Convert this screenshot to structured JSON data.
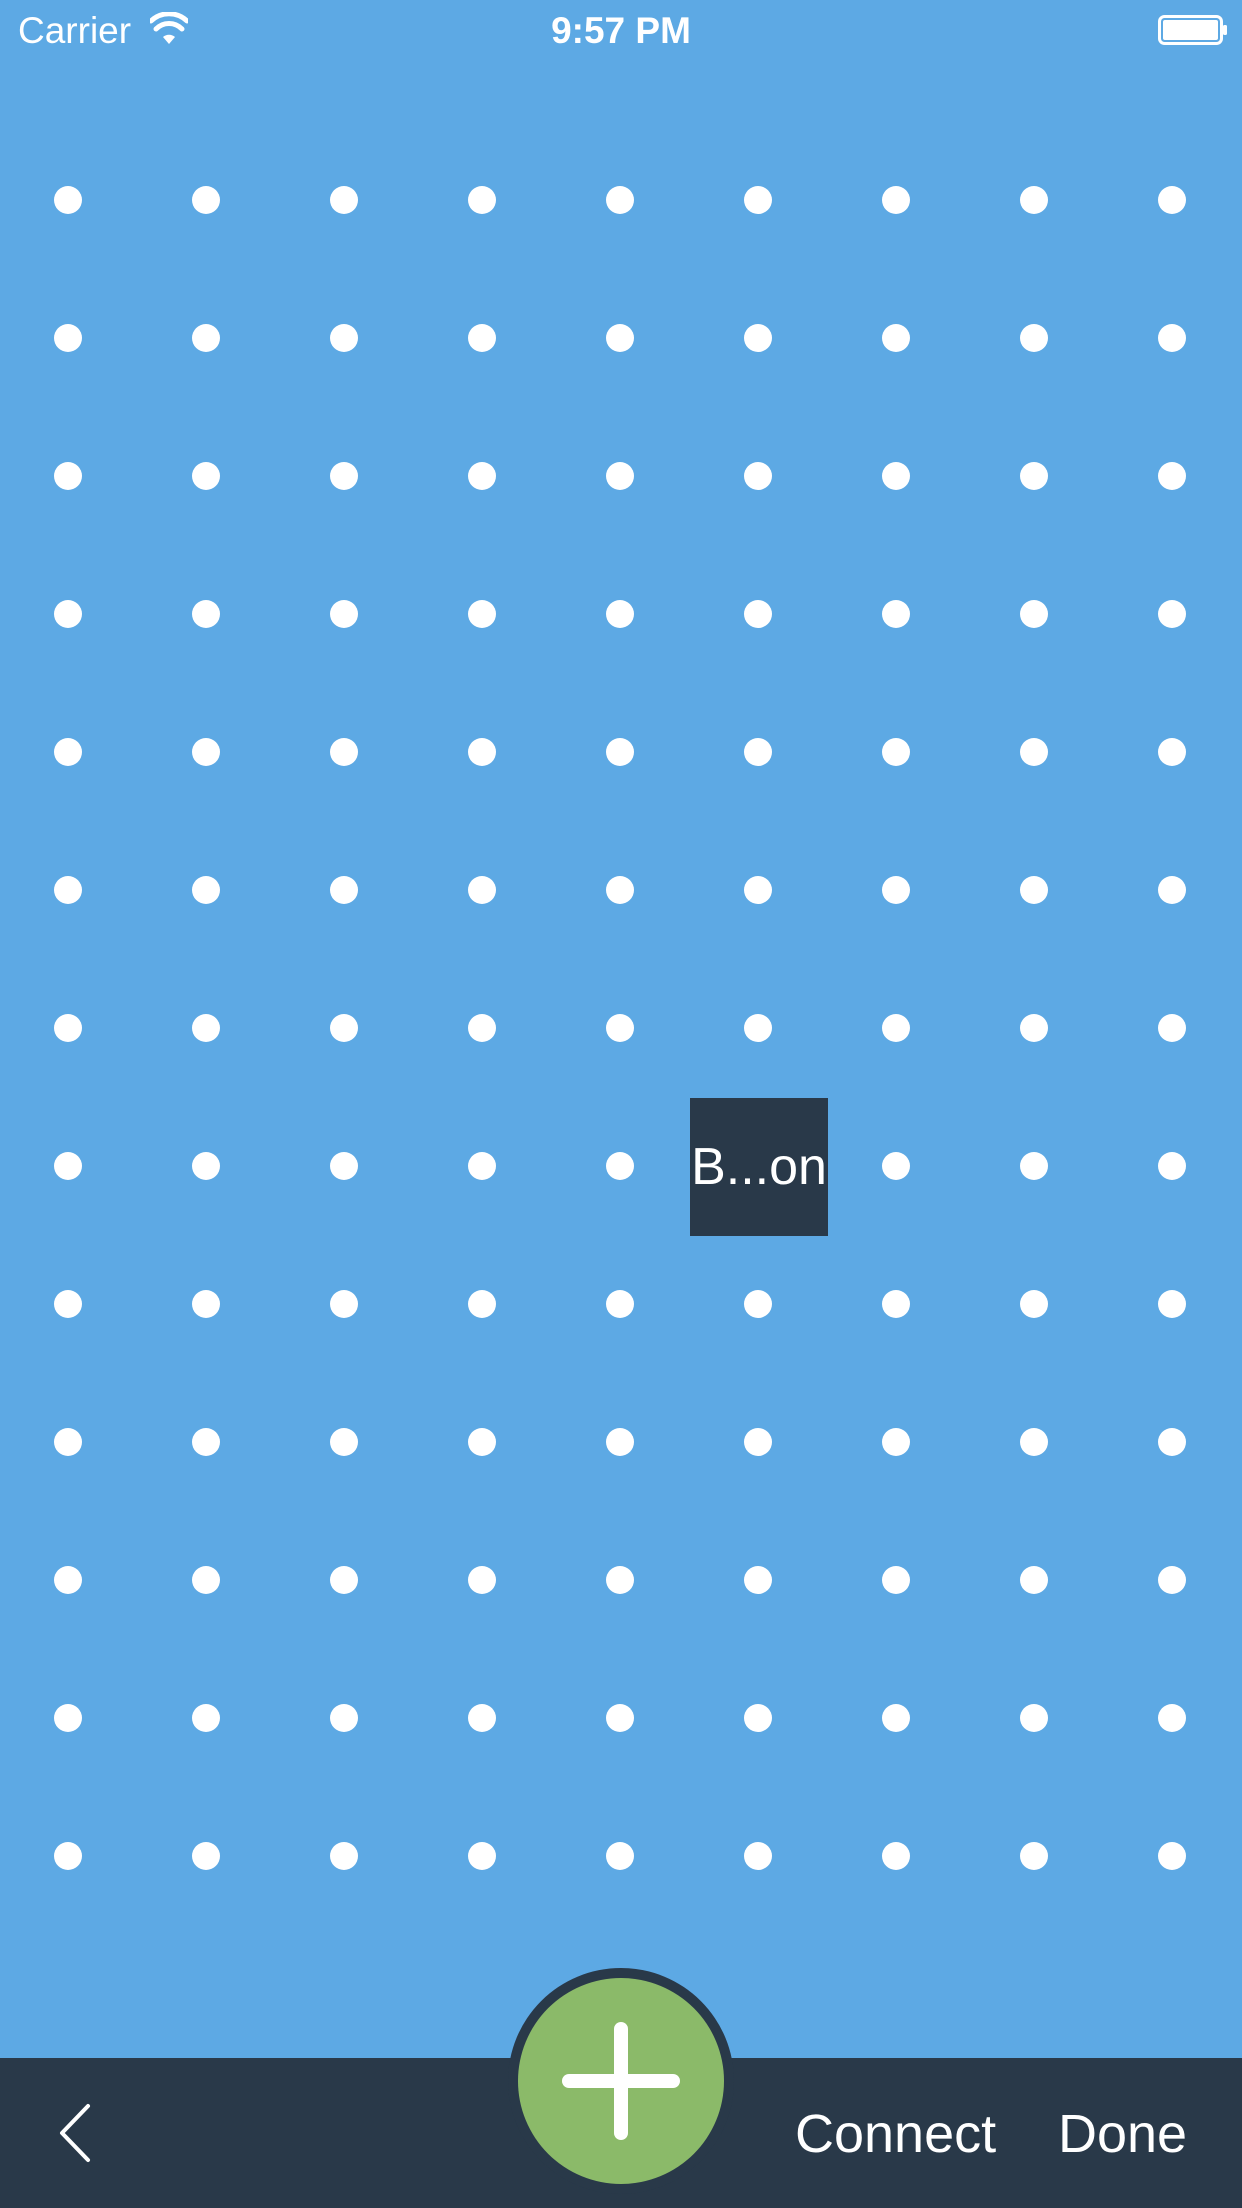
{
  "status_bar": {
    "carrier": "Carrier",
    "time": "9:57 PM",
    "wifi_icon": "wifi-icon",
    "battery_icon": "battery-icon"
  },
  "canvas": {
    "background_color": "#5DA9E4",
    "dot_color": "#FFFFFF",
    "grid_rows": 13,
    "grid_columns": 9,
    "placed_component": {
      "label": "B...on",
      "color": "#293949"
    }
  },
  "toolbar": {
    "back_icon": "chevron-left-icon",
    "add_icon": "plus-icon",
    "add_button_color": "#8BBA69",
    "connect_label": "Connect",
    "done_label": "Done",
    "background_color": "#293949"
  }
}
